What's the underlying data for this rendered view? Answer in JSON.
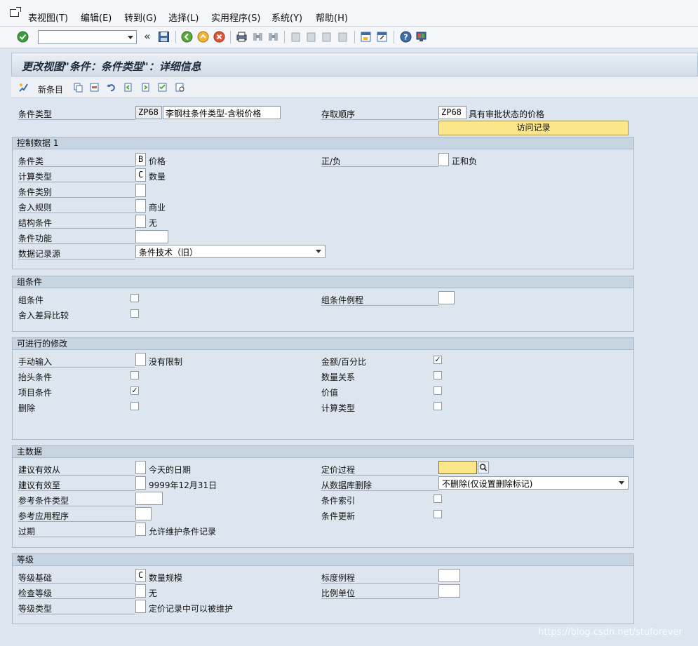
{
  "menu": {
    "items": [
      "表视图(T)",
      "编辑(E)",
      "转到(G)",
      "选择(L)",
      "实用程序(S)",
      "系统(Y)",
      "帮助(H)"
    ]
  },
  "toolbar": {
    "command_value": "",
    "chevron": "«"
  },
  "title": "更改视图\"条件：条件类型\"：详细信息",
  "app_toolbar": {
    "new_entries": "新条目"
  },
  "header": {
    "condition_type_label": "条件类型",
    "condition_type_code": "ZP68",
    "condition_type_desc": "李钢柱条件类型-含税价格",
    "access_seq_label": "存取顺序",
    "access_seq_code": "ZP68",
    "access_seq_desc": "具有审批状态的价格",
    "access_records_button": "访问记录"
  },
  "control_data": {
    "title": "控制数据 1",
    "cond_class_label": "条件类",
    "cond_class_value": "B",
    "cond_class_text": "价格",
    "calc_type_label": "计算类型",
    "calc_type_value": "C",
    "calc_type_text": "数量",
    "cond_category_label": "条件类别",
    "cond_category_value": "",
    "rounding_label": "舍入规则",
    "rounding_value": "",
    "rounding_text": "商业",
    "structure_label": "结构条件",
    "structure_value": "",
    "structure_text": "无",
    "function_label": "条件功能",
    "function_value": "",
    "source_label": "数据记录源",
    "source_value": "条件技术（旧）",
    "plus_minus_label": "正/负",
    "plus_minus_value": "",
    "plus_minus_text": "正和负"
  },
  "group_cond": {
    "title": "组条件",
    "group_cond_label": "组条件",
    "group_cond_checked": false,
    "rounding_diff_label": "舍入差异比较",
    "rounding_diff_checked": false,
    "group_routine_label": "组条件例程",
    "group_routine_value": ""
  },
  "changes": {
    "title": "可进行的修改",
    "manual_label": "手动输入",
    "manual_value": "",
    "manual_text": "没有限制",
    "header_cond_label": "抬头条件",
    "header_cond_checked": false,
    "item_cond_label": "项目条件",
    "item_cond_checked": true,
    "delete_label": "删除",
    "delete_checked": false,
    "amount_label": "金额/百分比",
    "amount_checked": true,
    "qty_rel_label": "数量关系",
    "qty_rel_checked": false,
    "value_label": "价值",
    "value_checked": false,
    "calc_type_label": "计算类型",
    "calc_type_checked": false
  },
  "master_data": {
    "title": "主数据",
    "valid_from_label": "建议有效从",
    "valid_from_value": "",
    "valid_from_text": "今天的日期",
    "valid_to_label": "建议有效至",
    "valid_to_value": "",
    "valid_to_text": "9999年12月31日",
    "ref_cond_label": "参考条件类型",
    "ref_cond_value": "",
    "ref_app_label": "参考应用程序",
    "ref_app_value": "",
    "expiry_label": "过期",
    "expiry_value": "",
    "expiry_text": "允许维护条件记录",
    "pricing_proc_label": "定价过程",
    "pricing_proc_value": "",
    "delete_db_label": "从数据库删除",
    "delete_db_value": "不删除(仅设置删除标记)",
    "cond_index_label": "条件索引",
    "cond_index_checked": false,
    "cond_update_label": "条件更新",
    "cond_update_checked": false
  },
  "scales": {
    "title": "等级",
    "scale_base_label": "等级基础",
    "scale_base_value": "C",
    "scale_base_text": "数量规模",
    "check_scale_label": "检查等级",
    "check_scale_value": "",
    "check_scale_text": "无",
    "scale_type_label": "等级类型",
    "scale_type_value": "",
    "scale_type_text": "定价记录中可以被维护",
    "scale_routine_label": "标度例程",
    "scale_routine_value": "",
    "scale_unit_label": "比例单位",
    "scale_unit_value": ""
  },
  "watermark": "https://blog.csdn.net/stuforever"
}
